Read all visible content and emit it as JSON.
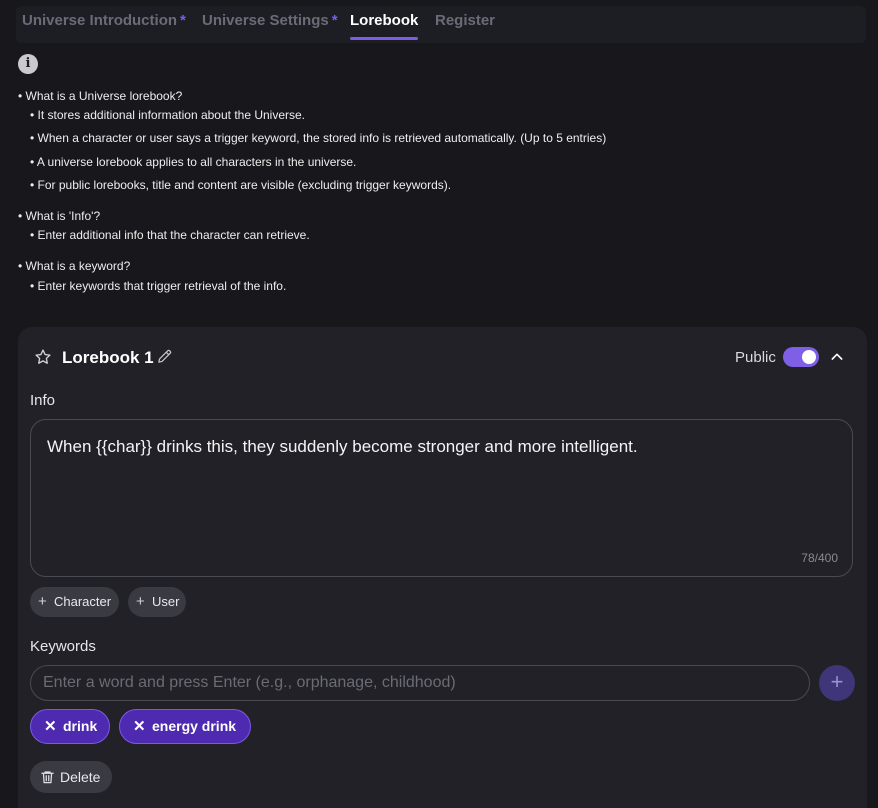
{
  "tabs": [
    {
      "label": "Universe Introduction",
      "modified": "*"
    },
    {
      "label": "Universe Settings",
      "modified": "*"
    },
    {
      "label": "Lorebook",
      "modified": ""
    },
    {
      "label": "Register",
      "modified": ""
    }
  ],
  "active_tab": "Lorebook",
  "info_icon_glyph": "i",
  "help": [
    "• What is a Universe lorebook?",
    "• It stores additional information about the Universe.",
    "• When a character or user says a trigger keyword, the stored info is retrieved automatically. (Up to 5 entries)",
    "• A universe lorebook applies to all characters in the universe.",
    "• For public lorebooks, title and content are visible (excluding trigger keywords).",
    "• What is 'Info'?",
    "• Enter additional info that the character can retrieve.",
    "• What is a keyword?",
    "• Enter keywords that trigger retrieval of the info."
  ],
  "lorebook": {
    "title": "Lorebook 1",
    "public_label": "Public",
    "public_on": true,
    "info_label": "Info",
    "info_text": "When {{char}} drinks this, they suddenly become stronger and more intelligent.",
    "char_count": "78/400",
    "insert_buttons": [
      "Character",
      "User"
    ],
    "keywords_label": "Keywords",
    "keyword_placeholder": "Enter a word and press Enter (e.g., orphanage, childhood)",
    "keywords": [
      "drink",
      "energy drink"
    ],
    "delete_label": "Delete"
  },
  "colors": {
    "accent": "#7c5ce8",
    "tag_bg": "#4d2ab0",
    "background": "#17171c",
    "card": "#212127"
  }
}
